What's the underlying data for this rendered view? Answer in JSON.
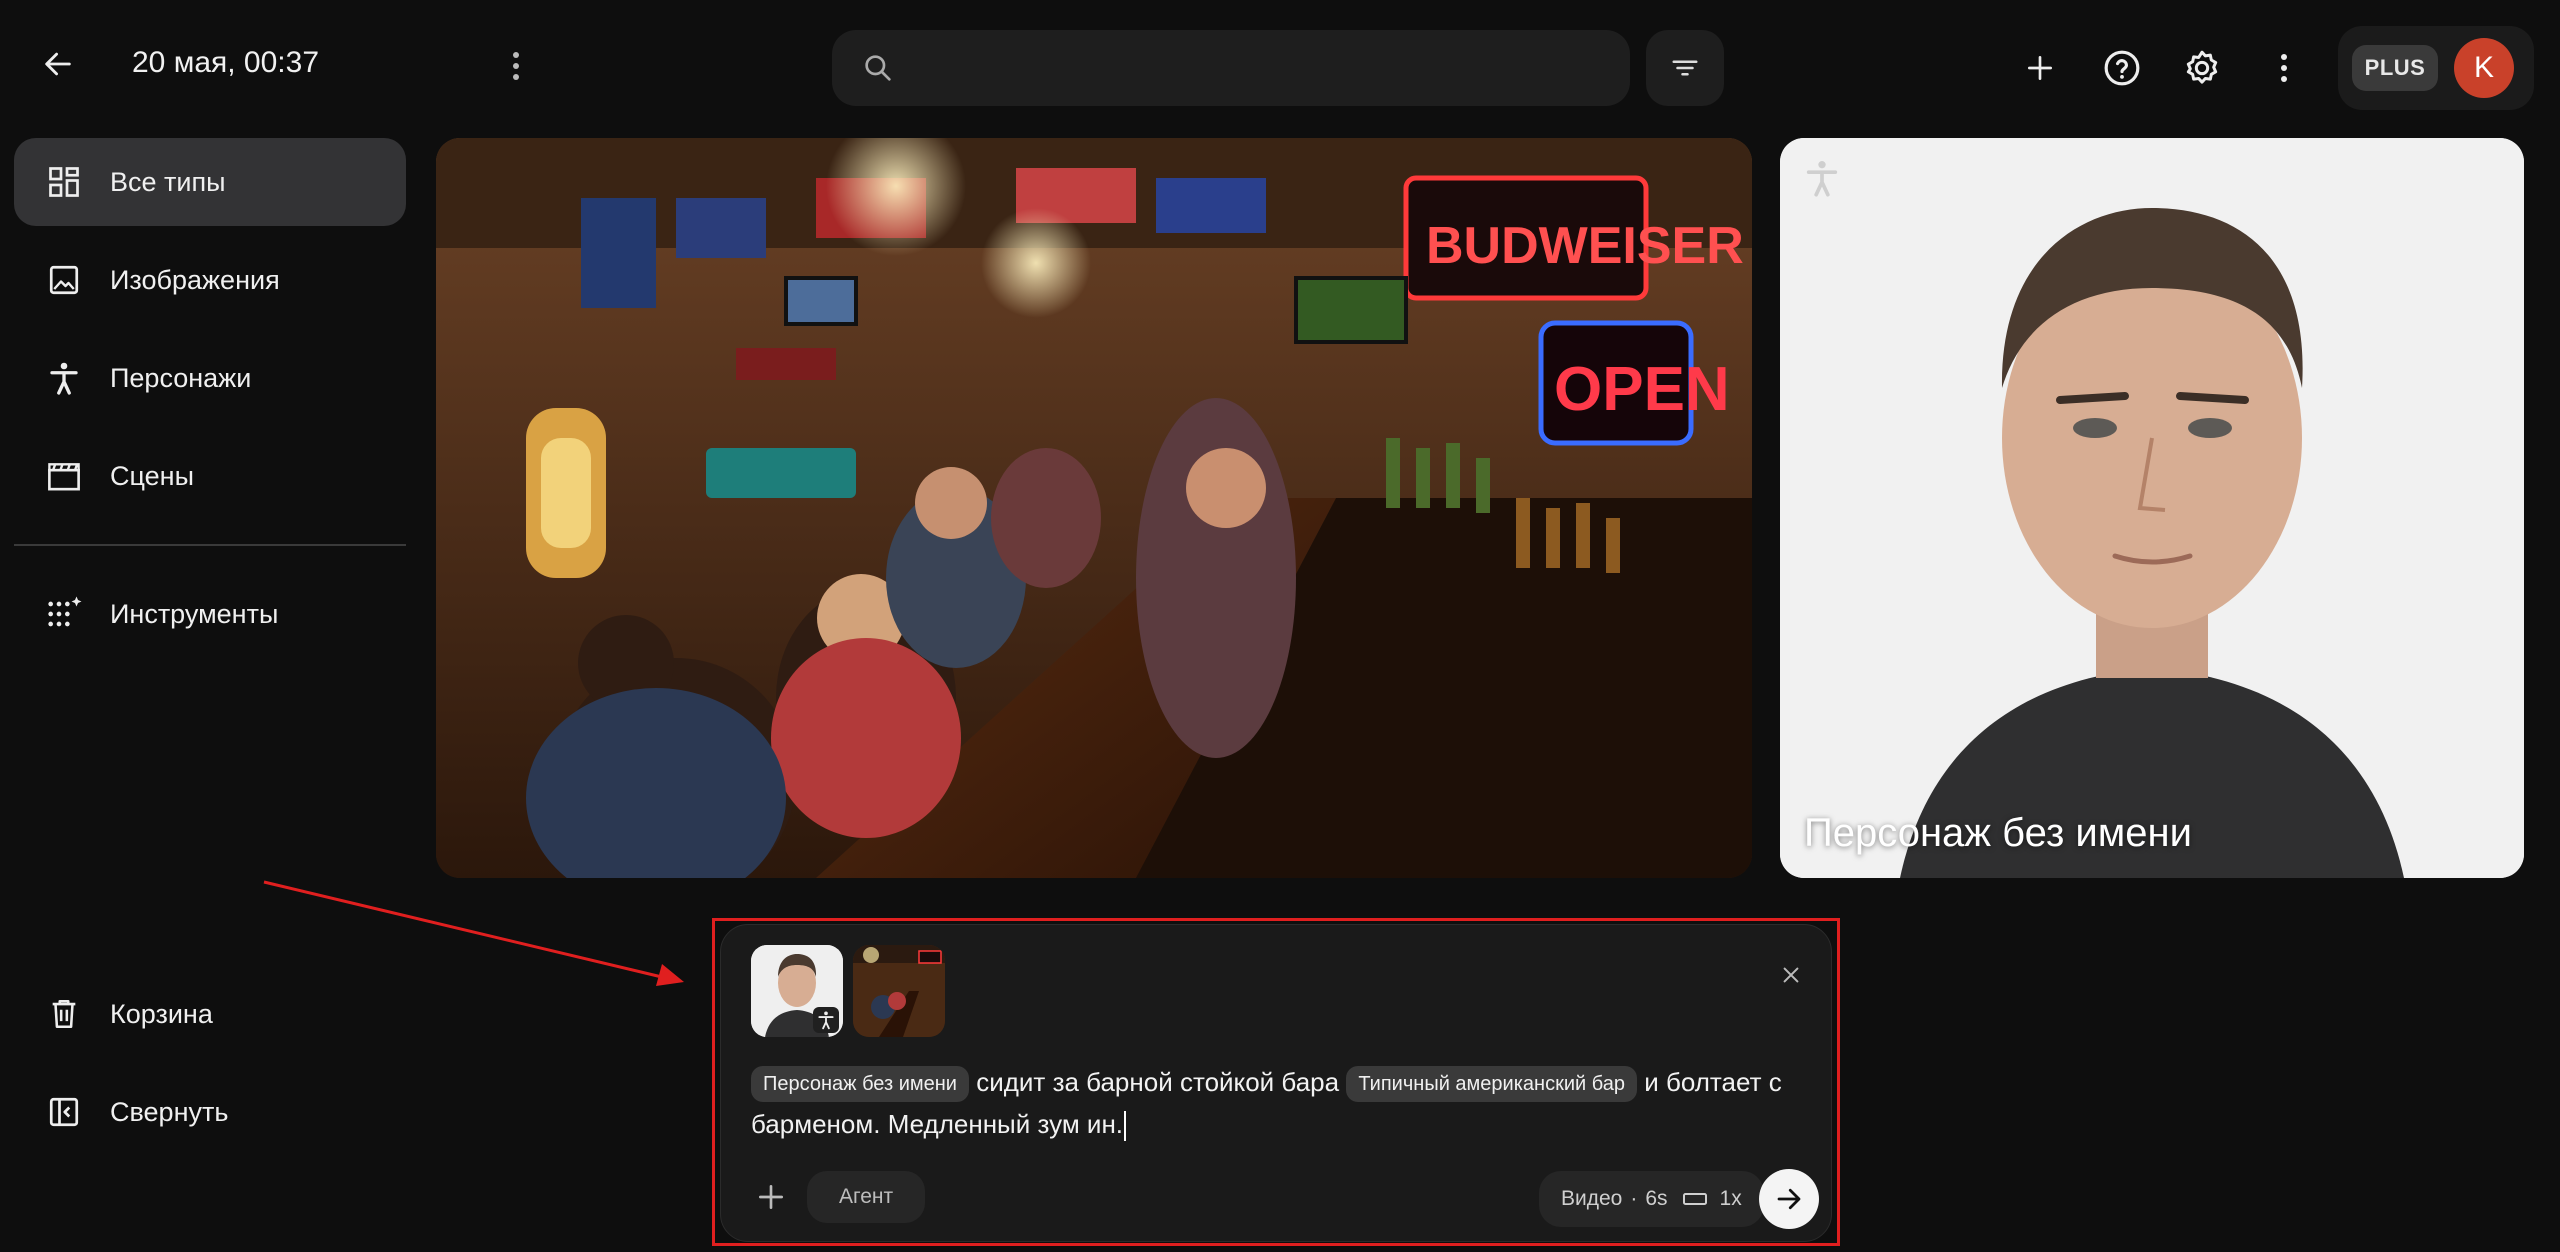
{
  "header": {
    "title": "20 мая, 00:37",
    "search_placeholder": "",
    "plan_badge": "PLUS",
    "avatar_letter": "K"
  },
  "sidebar": {
    "items": [
      {
        "label": "Все типы",
        "icon": "grid-icon",
        "active": true
      },
      {
        "label": "Изображения",
        "icon": "image-icon",
        "active": false
      },
      {
        "label": "Персонажи",
        "icon": "person-icon",
        "active": false
      },
      {
        "label": "Сцены",
        "icon": "clapperboard-icon",
        "active": false
      },
      {
        "label": "Инструменты",
        "icon": "sparkle-dots-icon",
        "active": false
      }
    ],
    "bottom_items": [
      {
        "label": "Корзина",
        "icon": "trash-icon"
      },
      {
        "label": "Свернуть",
        "icon": "collapse-sidebar-icon"
      }
    ]
  },
  "gallery": {
    "cards": [
      {
        "type": "scene",
        "title": ""
      },
      {
        "type": "character",
        "title": "Персонаж без имени"
      }
    ]
  },
  "composer": {
    "chip_character": "Персонаж без имени",
    "text_1": "сидит за барной стойкой бара",
    "chip_scene": "Типичный американский бар",
    "text_2": "и болтает с барменом. Медленный зум ин.",
    "agent_label": "Агент",
    "media_type": "Видео",
    "duration": "6s",
    "count": "1x"
  },
  "colors": {
    "annotation": "#e01f1f",
    "avatar": "#c9412a",
    "background": "#0e0e0e"
  }
}
